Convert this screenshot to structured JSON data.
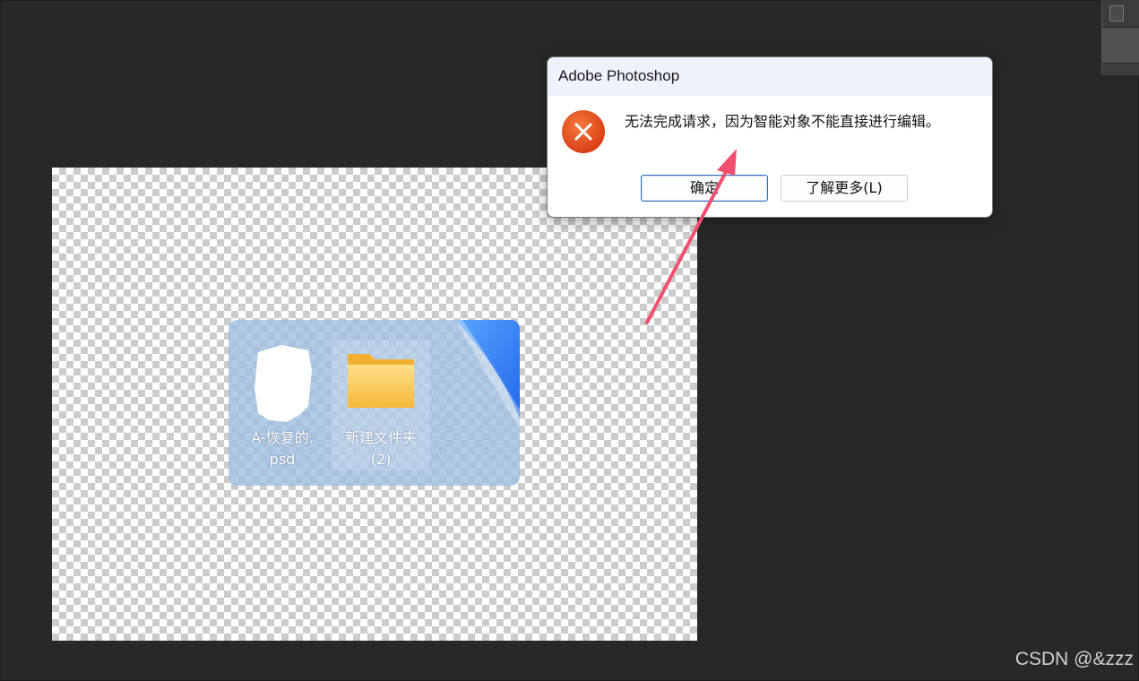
{
  "dialog": {
    "title": "Adobe Photoshop",
    "message": "无法完成请求，因为智能对象不能直接进行编辑。",
    "ok_label": "确定",
    "learn_more_label": "了解更多(L)",
    "icon": "error-x-icon"
  },
  "canvas": {
    "files": [
      {
        "label_line1": "A-恢复的.",
        "label_line2": "psd",
        "icon": "psd-file-icon"
      },
      {
        "label_line1": "新建文件夹",
        "label_line2": "(2)",
        "icon": "folder-icon"
      }
    ]
  },
  "watermark": "CSDN @&zzz",
  "colors": {
    "workspace": "#282828",
    "error_red": "#e0461f",
    "arrow_pink": "#f0506e",
    "folder_yellow": "#f7c948",
    "swoosh_blue": "#1e6ff5"
  }
}
